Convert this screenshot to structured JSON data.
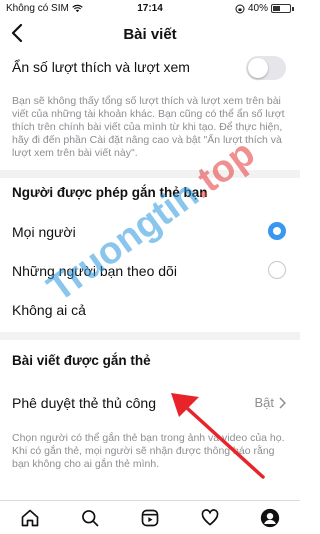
{
  "status_bar": {
    "carrier": "Không có SIM",
    "time": "17:14",
    "battery": "40%"
  },
  "nav": {
    "title": "Bài viết"
  },
  "hide_likes": {
    "label": "Ẩn số lượt thích và lượt xem",
    "toggle_on": false,
    "description": "Bạn sẽ không thấy tổng số lượt thích và lượt xem trên bài viết của những tài khoản khác. Bạn cũng có thể ẩn số lượt thích trên chính bài viết của mình từ khi tạo. Để thực hiện, hãy đi đến phần Cài đặt nâng cao và bật \"Ẩn lượt thích và lượt xem trên bài viết này\"."
  },
  "tag_permissions": {
    "title": "Người được phép gắn thẻ bạn",
    "options": [
      {
        "label": "Mọi người",
        "selected": true
      },
      {
        "label": "Những người bạn theo dõi",
        "selected": false
      },
      {
        "label": "Không ai cả",
        "selected": false
      }
    ]
  },
  "tagged_posts": {
    "title": "Bài viết được gắn thẻ",
    "manual_approval_label": "Phê duyệt thẻ thủ công",
    "manual_approval_value": "Bật",
    "description": "Chọn người có thể gắn thẻ bạn trong ảnh và video của họ. Khi có gắn thẻ, mọi người sẽ nhận được thông báo rằng bạn không cho ai gắn thẻ mình."
  },
  "watermark": {
    "text": "Truongtin",
    "suffix": ".top"
  },
  "colors": {
    "accent": "#3897f0",
    "secondary_text": "#8e8e93",
    "divider": "#f2f2f2"
  },
  "tabbar": {
    "icons": [
      "home-icon",
      "search-icon",
      "reels-icon",
      "heart-icon",
      "profile-icon"
    ]
  }
}
